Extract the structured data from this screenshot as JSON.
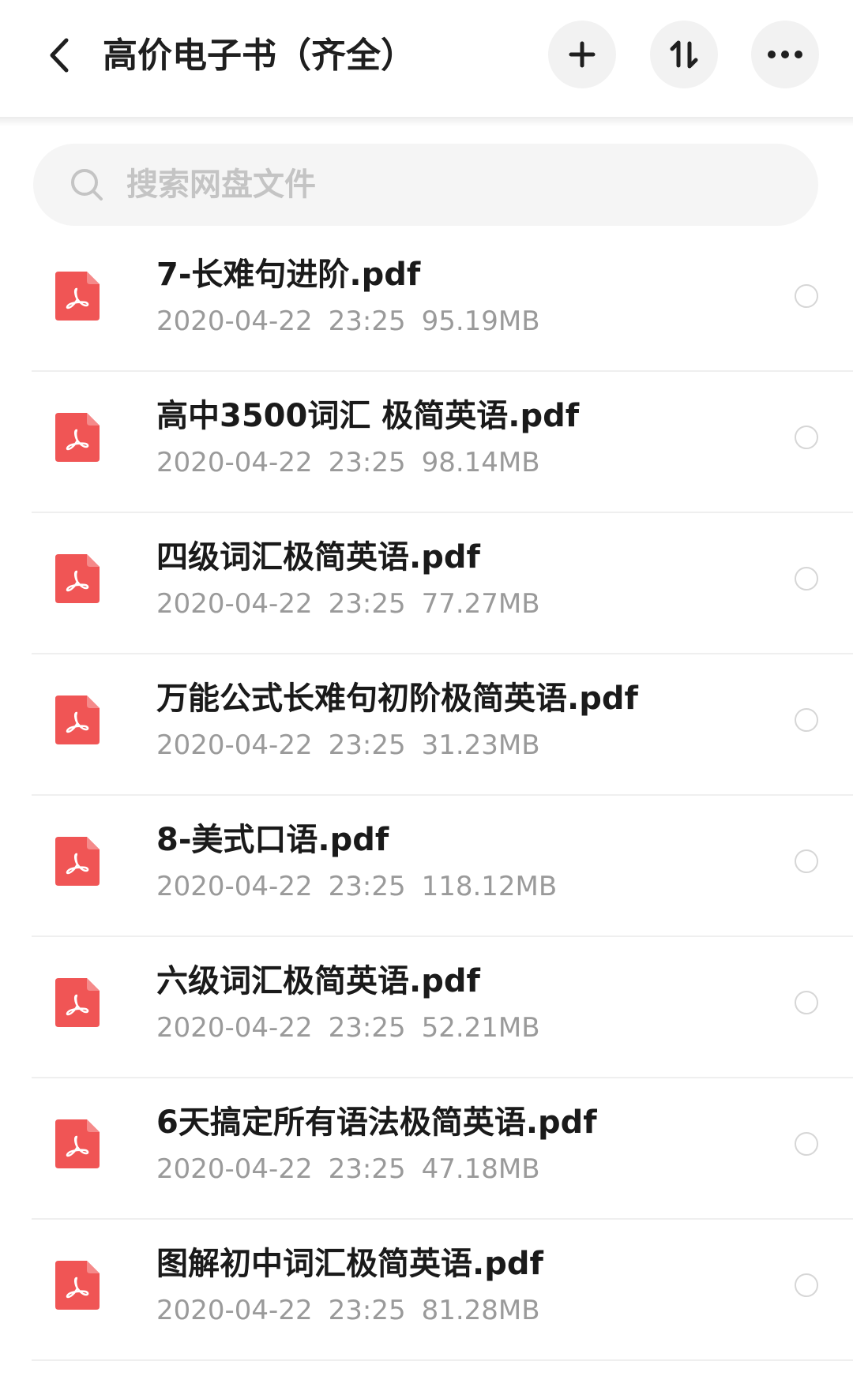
{
  "header": {
    "title": "高价电子书（齐全）"
  },
  "search": {
    "placeholder": "搜索网盘文件"
  },
  "files": [
    {
      "name": "7-长难句进阶.pdf",
      "date": "2020-04-22",
      "time": "23:25",
      "size": "95.19MB"
    },
    {
      "name": "高中3500词汇 极简英语.pdf",
      "date": "2020-04-22",
      "time": "23:25",
      "size": "98.14MB"
    },
    {
      "name": "四级词汇极简英语.pdf",
      "date": "2020-04-22",
      "time": "23:25",
      "size": "77.27MB"
    },
    {
      "name": "万能公式长难句初阶极简英语.pdf",
      "date": "2020-04-22",
      "time": "23:25",
      "size": "31.23MB"
    },
    {
      "name": "8-美式口语.pdf",
      "date": "2020-04-22",
      "time": "23:25",
      "size": "118.12MB"
    },
    {
      "name": "六级词汇极简英语.pdf",
      "date": "2020-04-22",
      "time": "23:25",
      "size": "52.21MB"
    },
    {
      "name": "6天搞定所有语法极简英语.pdf",
      "date": "2020-04-22",
      "time": "23:25",
      "size": "47.18MB"
    },
    {
      "name": "图解初中词汇极简英语.pdf",
      "date": "2020-04-22",
      "time": "23:25",
      "size": "81.28MB"
    }
  ],
  "icons": {
    "back": "chevron-left-icon",
    "add": "plus-icon",
    "sort": "sort-icon",
    "more": "more-dots-icon",
    "search": "search-icon",
    "file": "pdf-file-icon"
  },
  "colors": {
    "pdf_icon": "#f05555",
    "meta_text": "#9a9a9a",
    "button_bg": "#f2f2f2"
  }
}
